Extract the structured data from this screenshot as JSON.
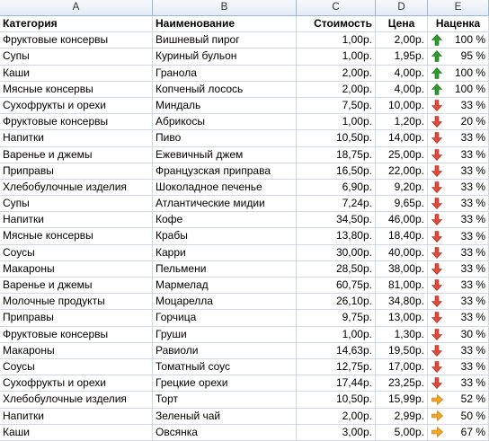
{
  "column_letters": [
    "A",
    "B",
    "C",
    "D",
    "E"
  ],
  "headers": [
    "Категория",
    "Наименование",
    "Стоимость",
    "Цена",
    "Наценка"
  ],
  "icon_colors": {
    "up": "#2e9a2e",
    "down": "#e04a3a",
    "right": "#f2a51e"
  },
  "rows": [
    {
      "category": "Фруктовые консервы",
      "name": "Вишневый пирог",
      "cost": "1,00р.",
      "price": "2,00р.",
      "icon": "arrow-up-icon",
      "markup": "100 %"
    },
    {
      "category": "Супы",
      "name": "Куриный бульон",
      "cost": "1,00р.",
      "price": "1,95р.",
      "icon": "arrow-up-icon",
      "markup": "95 %"
    },
    {
      "category": "Каши",
      "name": "Гранола",
      "cost": "2,00р.",
      "price": "4,00р.",
      "icon": "arrow-up-icon",
      "markup": "100 %"
    },
    {
      "category": "Мясные консервы",
      "name": "Копченый лосось",
      "cost": "2,00р.",
      "price": "4,00р.",
      "icon": "arrow-up-icon",
      "markup": "100 %"
    },
    {
      "category": "Сухофрукты и орехи",
      "name": "Миндаль",
      "cost": "7,50р.",
      "price": "10,00р.",
      "icon": "arrow-down-icon",
      "markup": "33 %"
    },
    {
      "category": "Фруктовые консервы",
      "name": "Абрикосы",
      "cost": "1,00р.",
      "price": "1,20р.",
      "icon": "arrow-down-icon",
      "markup": "20 %"
    },
    {
      "category": "Напитки",
      "name": "Пиво",
      "cost": "10,50р.",
      "price": "14,00р.",
      "icon": "arrow-down-icon",
      "markup": "33 %"
    },
    {
      "category": "Варенье и джемы",
      "name": "Ежевичный джем",
      "cost": "18,75р.",
      "price": "25,00р.",
      "icon": "arrow-down-icon",
      "markup": "33 %"
    },
    {
      "category": "Приправы",
      "name": "Французская приправа",
      "cost": "16,50р.",
      "price": "22,00р.",
      "icon": "arrow-down-icon",
      "markup": "33 %"
    },
    {
      "category": "Хлебобулочные изделия",
      "name": "Шоколадное печенье",
      "cost": "6,90р.",
      "price": "9,20р.",
      "icon": "arrow-down-icon",
      "markup": "33 %"
    },
    {
      "category": "Супы",
      "name": "Атлантические мидии",
      "cost": "7,24р.",
      "price": "9,65р.",
      "icon": "arrow-down-icon",
      "markup": "33 %"
    },
    {
      "category": "Напитки",
      "name": "Кофе",
      "cost": "34,50р.",
      "price": "46,00р.",
      "icon": "arrow-down-icon",
      "markup": "33 %"
    },
    {
      "category": "Мясные консервы",
      "name": "Крабы",
      "cost": "13,80р.",
      "price": "18,40р.",
      "icon": "arrow-down-icon",
      "markup": "33 %"
    },
    {
      "category": "Соусы",
      "name": "Карри",
      "cost": "30,00р.",
      "price": "40,00р.",
      "icon": "arrow-down-icon",
      "markup": "33 %"
    },
    {
      "category": "Макароны",
      "name": "Пельмени",
      "cost": "28,50р.",
      "price": "38,00р.",
      "icon": "arrow-down-icon",
      "markup": "33 %"
    },
    {
      "category": "Варенье и джемы",
      "name": "Мармелад",
      "cost": "60,75р.",
      "price": "81,00р.",
      "icon": "arrow-down-icon",
      "markup": "33 %"
    },
    {
      "category": "Молочные продукты",
      "name": "Моцарелла",
      "cost": "26,10р.",
      "price": "34,80р.",
      "icon": "arrow-down-icon",
      "markup": "33 %"
    },
    {
      "category": "Приправы",
      "name": "Горчица",
      "cost": "9,75р.",
      "price": "13,00р.",
      "icon": "arrow-down-icon",
      "markup": "33 %"
    },
    {
      "category": "Фруктовые консервы",
      "name": "Груши",
      "cost": "1,00р.",
      "price": "1,30р.",
      "icon": "arrow-down-icon",
      "markup": "30 %"
    },
    {
      "category": "Макароны",
      "name": "Равиоли",
      "cost": "14,63р.",
      "price": "19,50р.",
      "icon": "arrow-down-icon",
      "markup": "33 %"
    },
    {
      "category": "Соусы",
      "name": "Томатный соус",
      "cost": "12,75р.",
      "price": "17,00р.",
      "icon": "arrow-down-icon",
      "markup": "33 %"
    },
    {
      "category": "Сухофрукты и орехи",
      "name": "Грецкие орехи",
      "cost": "17,44р.",
      "price": "23,25р.",
      "icon": "arrow-down-icon",
      "markup": "33 %"
    },
    {
      "category": "Хлебобулочные изделия",
      "name": "Торт",
      "cost": "10,50р.",
      "price": "15,99р.",
      "icon": "arrow-right-icon",
      "markup": "52 %"
    },
    {
      "category": "Напитки",
      "name": "Зеленый чай",
      "cost": "2,00р.",
      "price": "2,99р.",
      "icon": "arrow-right-icon",
      "markup": "50 %"
    },
    {
      "category": "Каши",
      "name": "Овсянка",
      "cost": "3,00р.",
      "price": "5,00р.",
      "icon": "arrow-right-icon",
      "markup": "67 %"
    }
  ]
}
